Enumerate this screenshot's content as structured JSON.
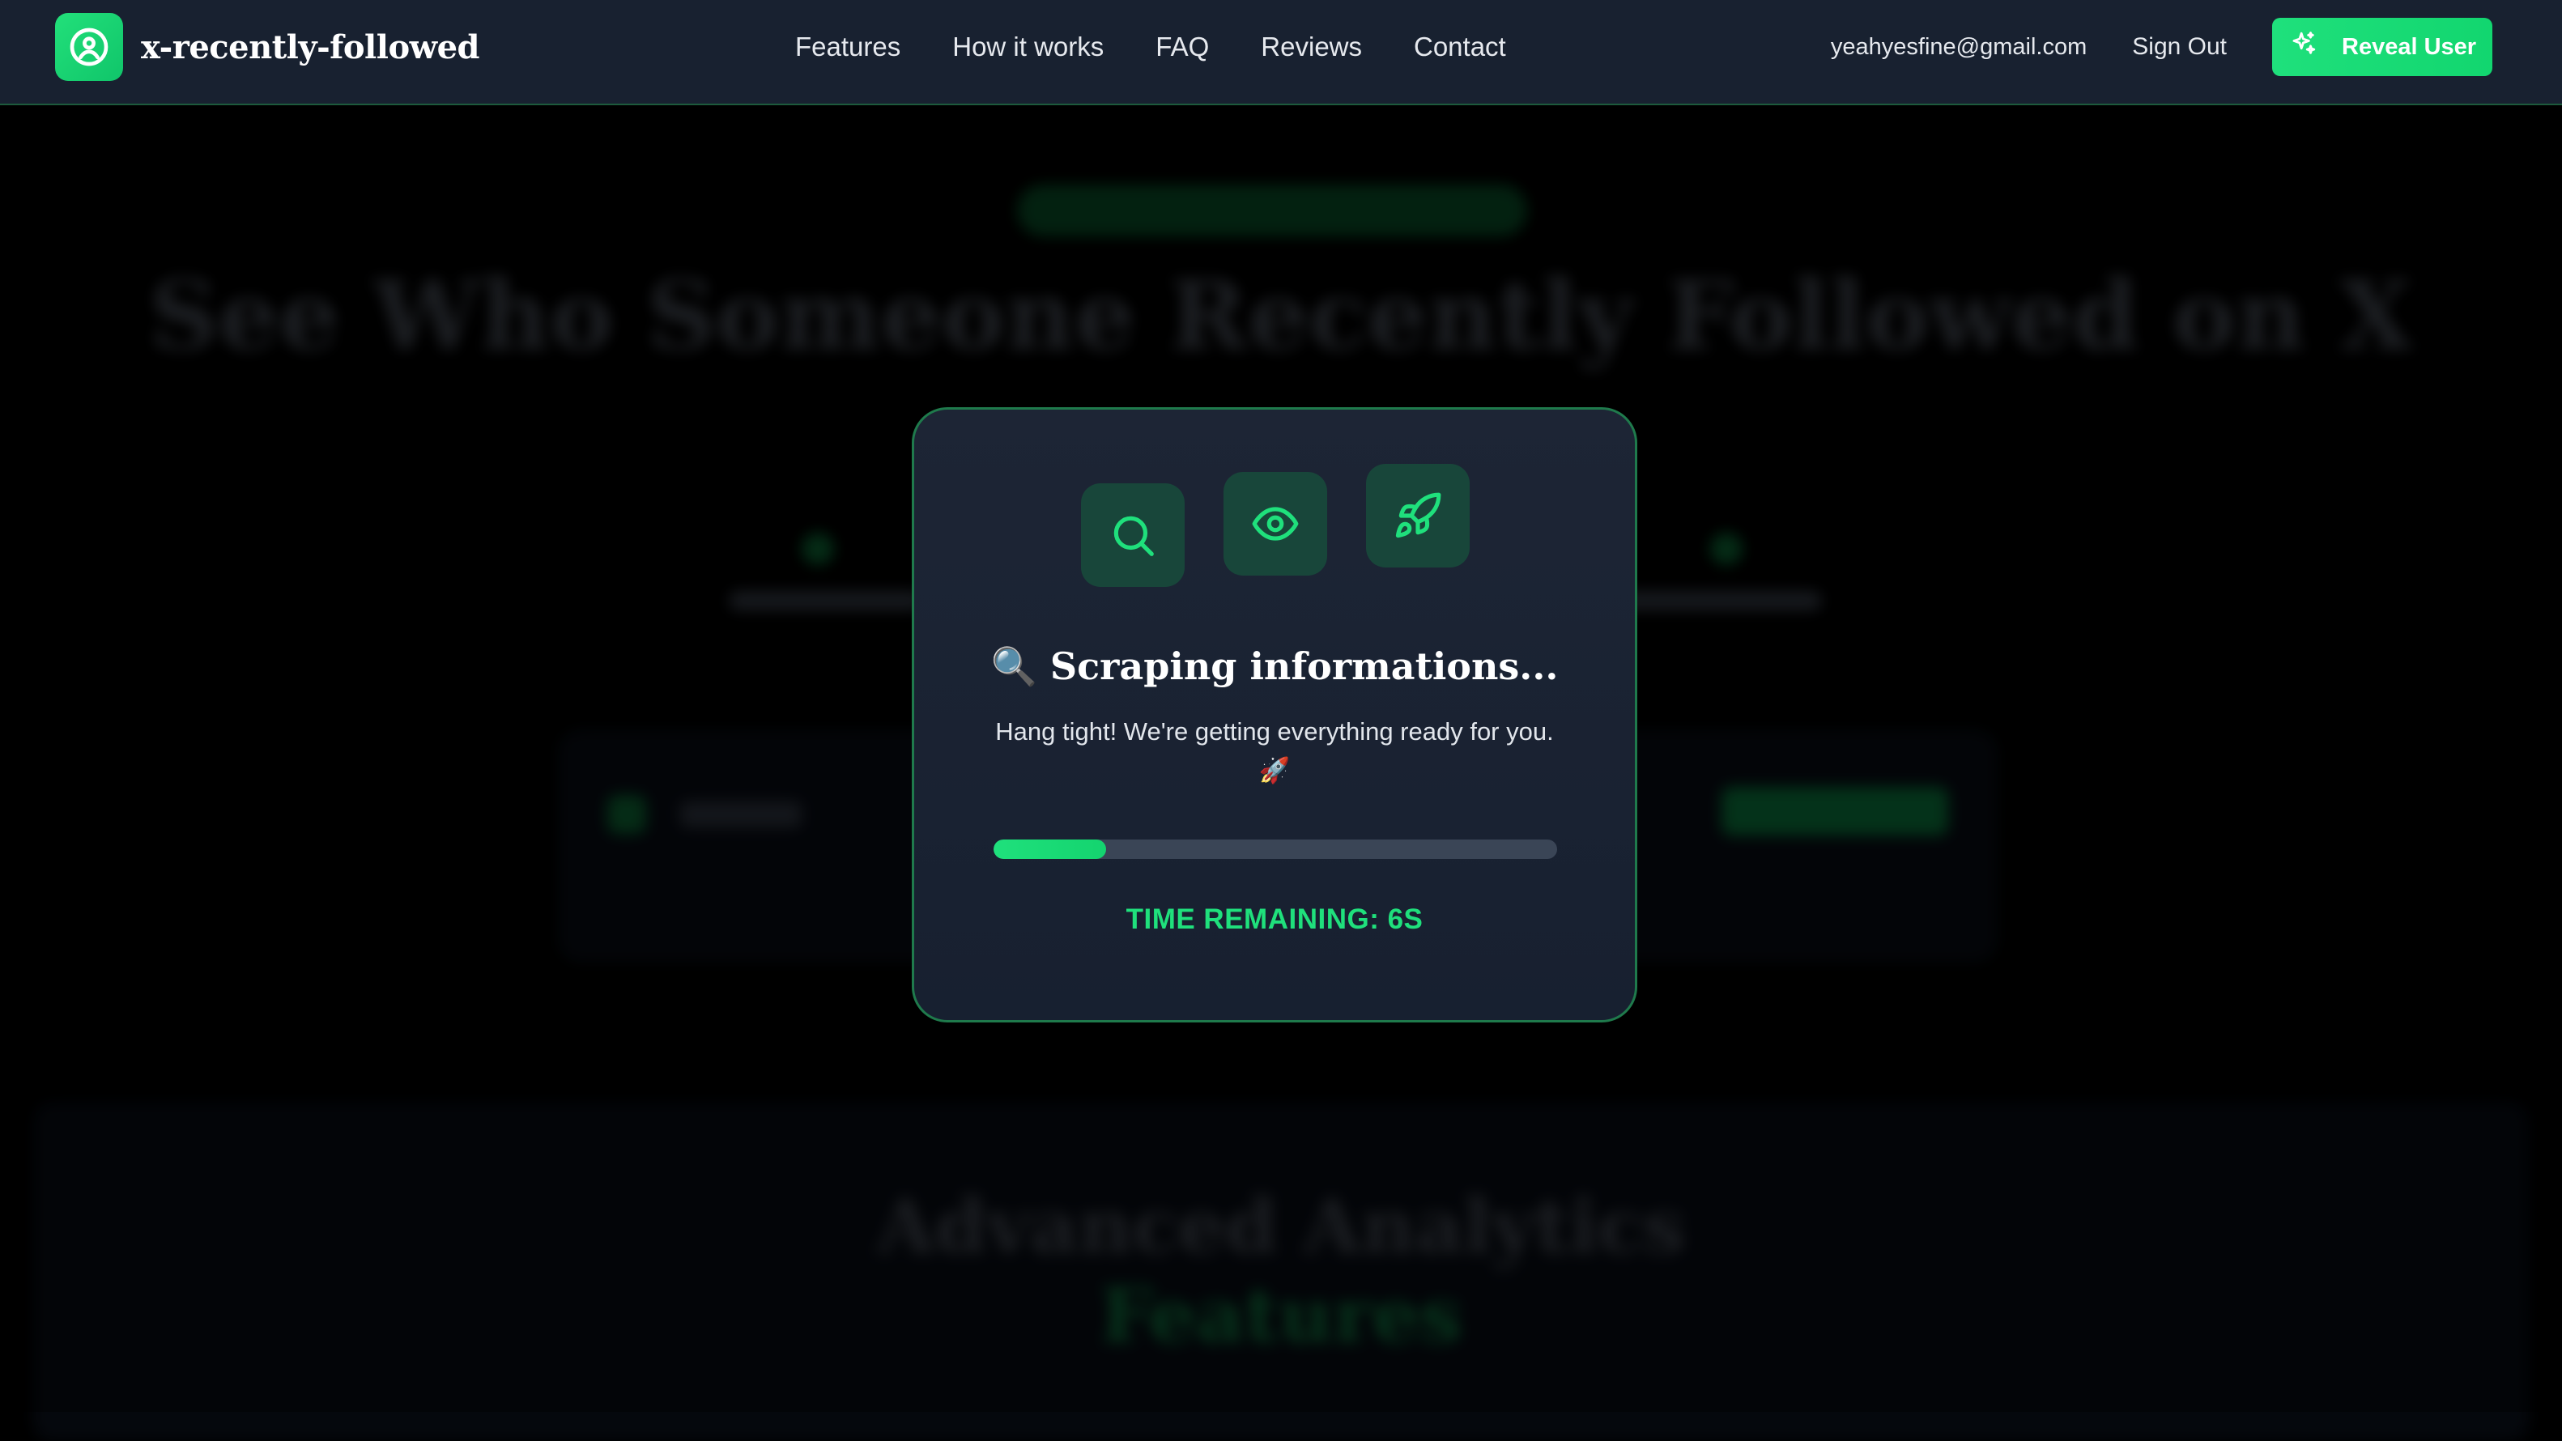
{
  "brand": {
    "name": "x-recently-followed"
  },
  "nav": {
    "links": [
      "Features",
      "How it works",
      "FAQ",
      "Reviews",
      "Contact"
    ]
  },
  "user": {
    "email": "yeahyesfine@gmail.com",
    "sign_out_label": "Sign Out",
    "reveal_label": "Reveal User"
  },
  "background": {
    "hero_title": "See Who Someone Recently Followed on X",
    "section_title_line1": "Advanced Analytics",
    "section_title_line2": "Features"
  },
  "modal": {
    "title": "🔍 Scraping informations...",
    "subtitle": "Hang tight! We're getting everything ready for you. 🚀",
    "progress_fraction": 0.2,
    "time_remaining": "TIME REMAINING: 6S",
    "icons": [
      "search-icon",
      "eye-icon",
      "rocket-icon"
    ]
  },
  "colors": {
    "accent": "#1fe07c",
    "nav_bg": "#182130",
    "modal_bg": "#1d2535",
    "icon_tile": "#18463a"
  }
}
